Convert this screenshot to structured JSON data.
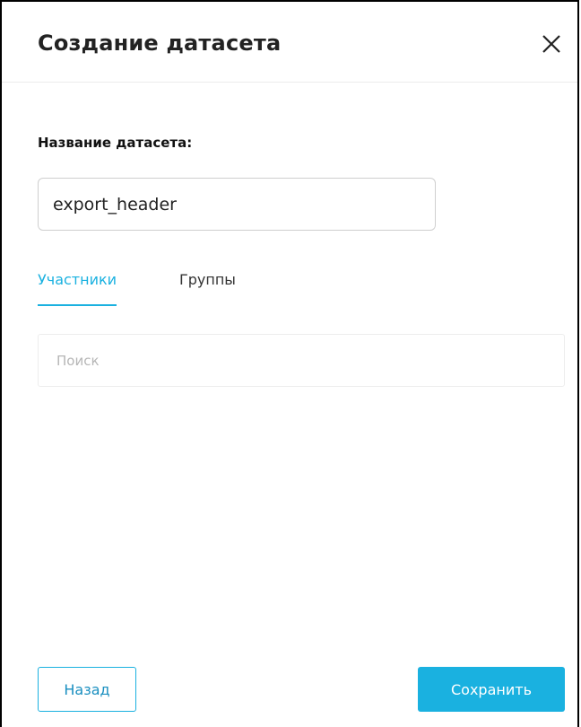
{
  "modal": {
    "title": "Создание датасета",
    "close_icon": "close-icon"
  },
  "form": {
    "name_label": "Название датасета:",
    "name_value": "export_header"
  },
  "tabs": [
    {
      "label": "Участники",
      "active": true
    },
    {
      "label": "Группы",
      "active": false
    }
  ],
  "search": {
    "placeholder": "Поиск",
    "value": ""
  },
  "footer": {
    "back_label": "Назад",
    "save_label": "Сохранить"
  },
  "colors": {
    "accent": "#1ab1e0",
    "text": "#222222",
    "border": "#cfcfcf"
  }
}
